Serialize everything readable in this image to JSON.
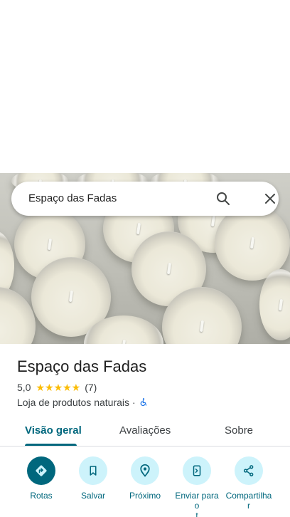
{
  "search": {
    "query": "Espaço das Fadas"
  },
  "place": {
    "name": "Espaço das Fadas",
    "rating": "5,0",
    "stars": "★★★★★",
    "review_count": "(7)",
    "category": "Loja de produtos naturais",
    "separator": "·"
  },
  "tabs": [
    {
      "label": "Visão geral",
      "active": true
    },
    {
      "label": "Avaliações",
      "active": false
    },
    {
      "label": "Sobre",
      "active": false
    }
  ],
  "actions": [
    {
      "label": "Rotas",
      "icon": "directions-icon"
    },
    {
      "label": "Salvar",
      "icon": "bookmark-icon"
    },
    {
      "label": "Próximo",
      "icon": "nearby-icon"
    },
    {
      "label": "Enviar para\no\nt",
      "icon": "send-to-phone-icon"
    },
    {
      "label": "Compartilha\nr",
      "icon": "share-icon"
    }
  ],
  "colors": {
    "accent": "#00677d",
    "accent_light": "#cdf3fb",
    "star": "#fbbc04"
  }
}
